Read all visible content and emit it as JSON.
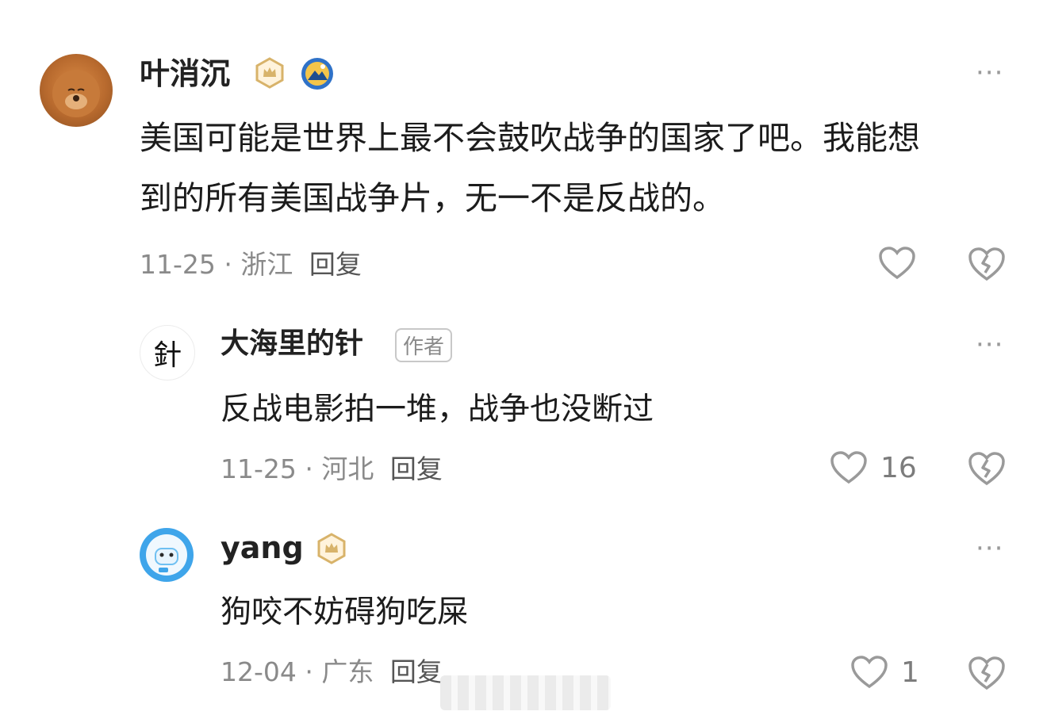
{
  "comments": [
    {
      "username": "叶消沉",
      "text_lines": [
        "美国可能是世界上最不会鼓吹战争的国家了吧。我能想",
        "到的所有美国战争片，无一不是反战的。"
      ],
      "date": "11-25",
      "separator": "·",
      "location": "浙江",
      "reply_label": "回复",
      "likes": "",
      "badges": [
        "crown-badge",
        "mountain-badge"
      ]
    },
    {
      "username": "大海里的针",
      "author_tag": "作者",
      "avatar_glyph": "針",
      "text_lines": [
        "反战电影拍一堆，战争也没断过"
      ],
      "date": "11-25",
      "separator": "·",
      "location": "河北",
      "reply_label": "回复",
      "likes": "16"
    },
    {
      "username": "yang",
      "text_lines": [
        "狗咬不妨碍狗吃屎"
      ],
      "date": "12-04",
      "separator": "·",
      "location": "广东",
      "reply_label": "回复",
      "likes": "1",
      "badges": [
        "crown-badge"
      ]
    }
  ],
  "more_label": "···",
  "colors": {
    "crown_gold": "#d8b36a",
    "icon_gray": "#9a9a9a",
    "avatar_blue": "#3fa5ea"
  }
}
